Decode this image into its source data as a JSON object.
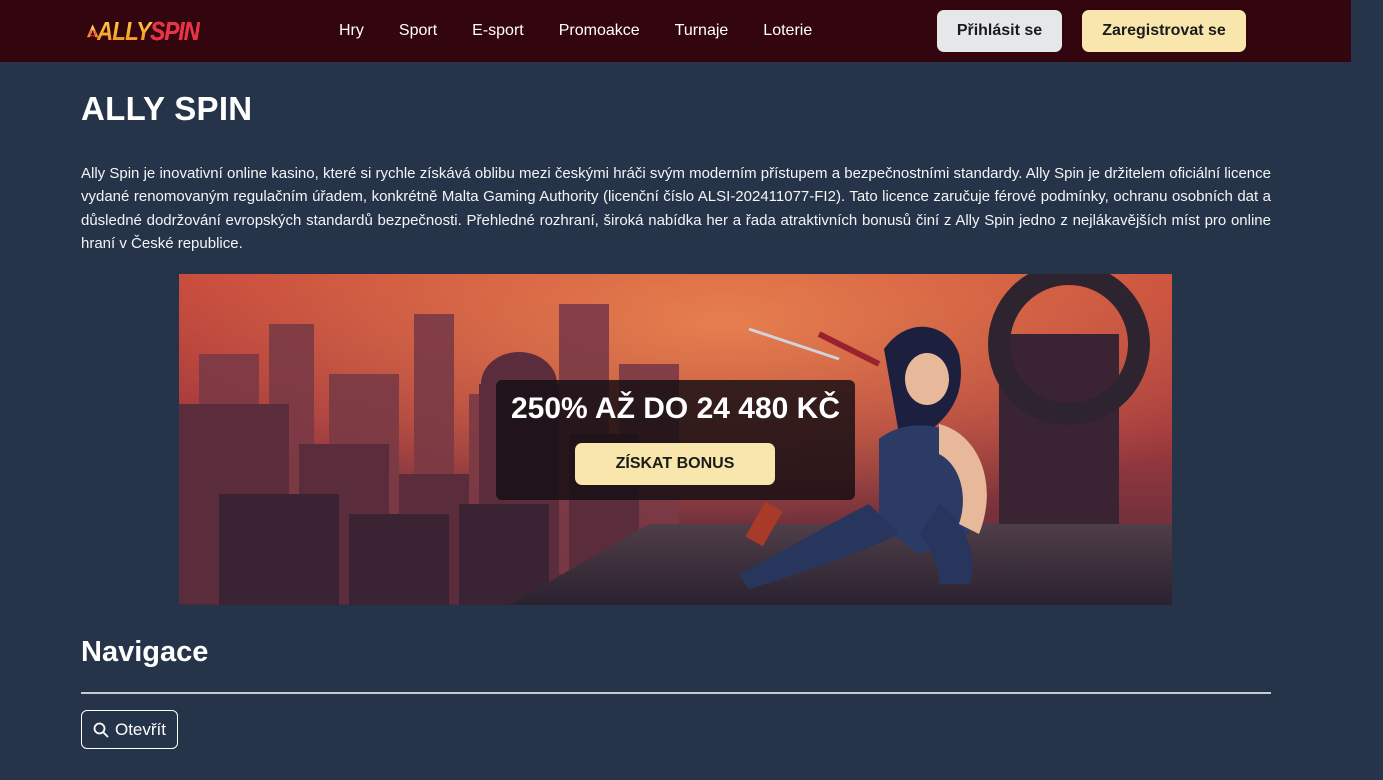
{
  "header": {
    "logo": {
      "part1": "ALLY",
      "part2": "SPIN"
    },
    "nav": [
      "Hry",
      "Sport",
      "E-sport",
      "Promoakce",
      "Turnaje",
      "Loterie"
    ],
    "login_label": "Přihlásit se",
    "register_label": "Zaregistrovat se"
  },
  "main": {
    "title": "ALLY SPIN",
    "intro": "Ally Spin je inovativní online kasino, které si rychle získává oblibu mezi českými hráči svým moderním přístupem a bezpečnostními standardy. Ally Spin je držitelem oficiální licence vydané renomovaným regulačním úřadem, konkrétně Malta Gaming Authority (licenční číslo ALSI-202411077-FI2). Tato licence zaručuje férové podmínky, ochranu osobních dat a důsledné dodržování evropských standardů bezpečnosti. Přehledné rozhraní, široká nabídka her a řada atraktivních bonusů činí z Ally Spin jedno z nejlákavějších míst pro online hraní v České republice.",
    "banner": {
      "headline": "250% AŽ DO 24 480 KČ",
      "cta_label": "ZÍSKAT BONUS"
    },
    "nav_section": {
      "title": "Navigace",
      "open_label": "Otevřít",
      "open_icon": "search-icon"
    }
  },
  "colors": {
    "header_bg": "#33060f",
    "page_bg": "#26344a",
    "accent_button": "#f8e6ad",
    "login_button": "#e6e7ea"
  }
}
